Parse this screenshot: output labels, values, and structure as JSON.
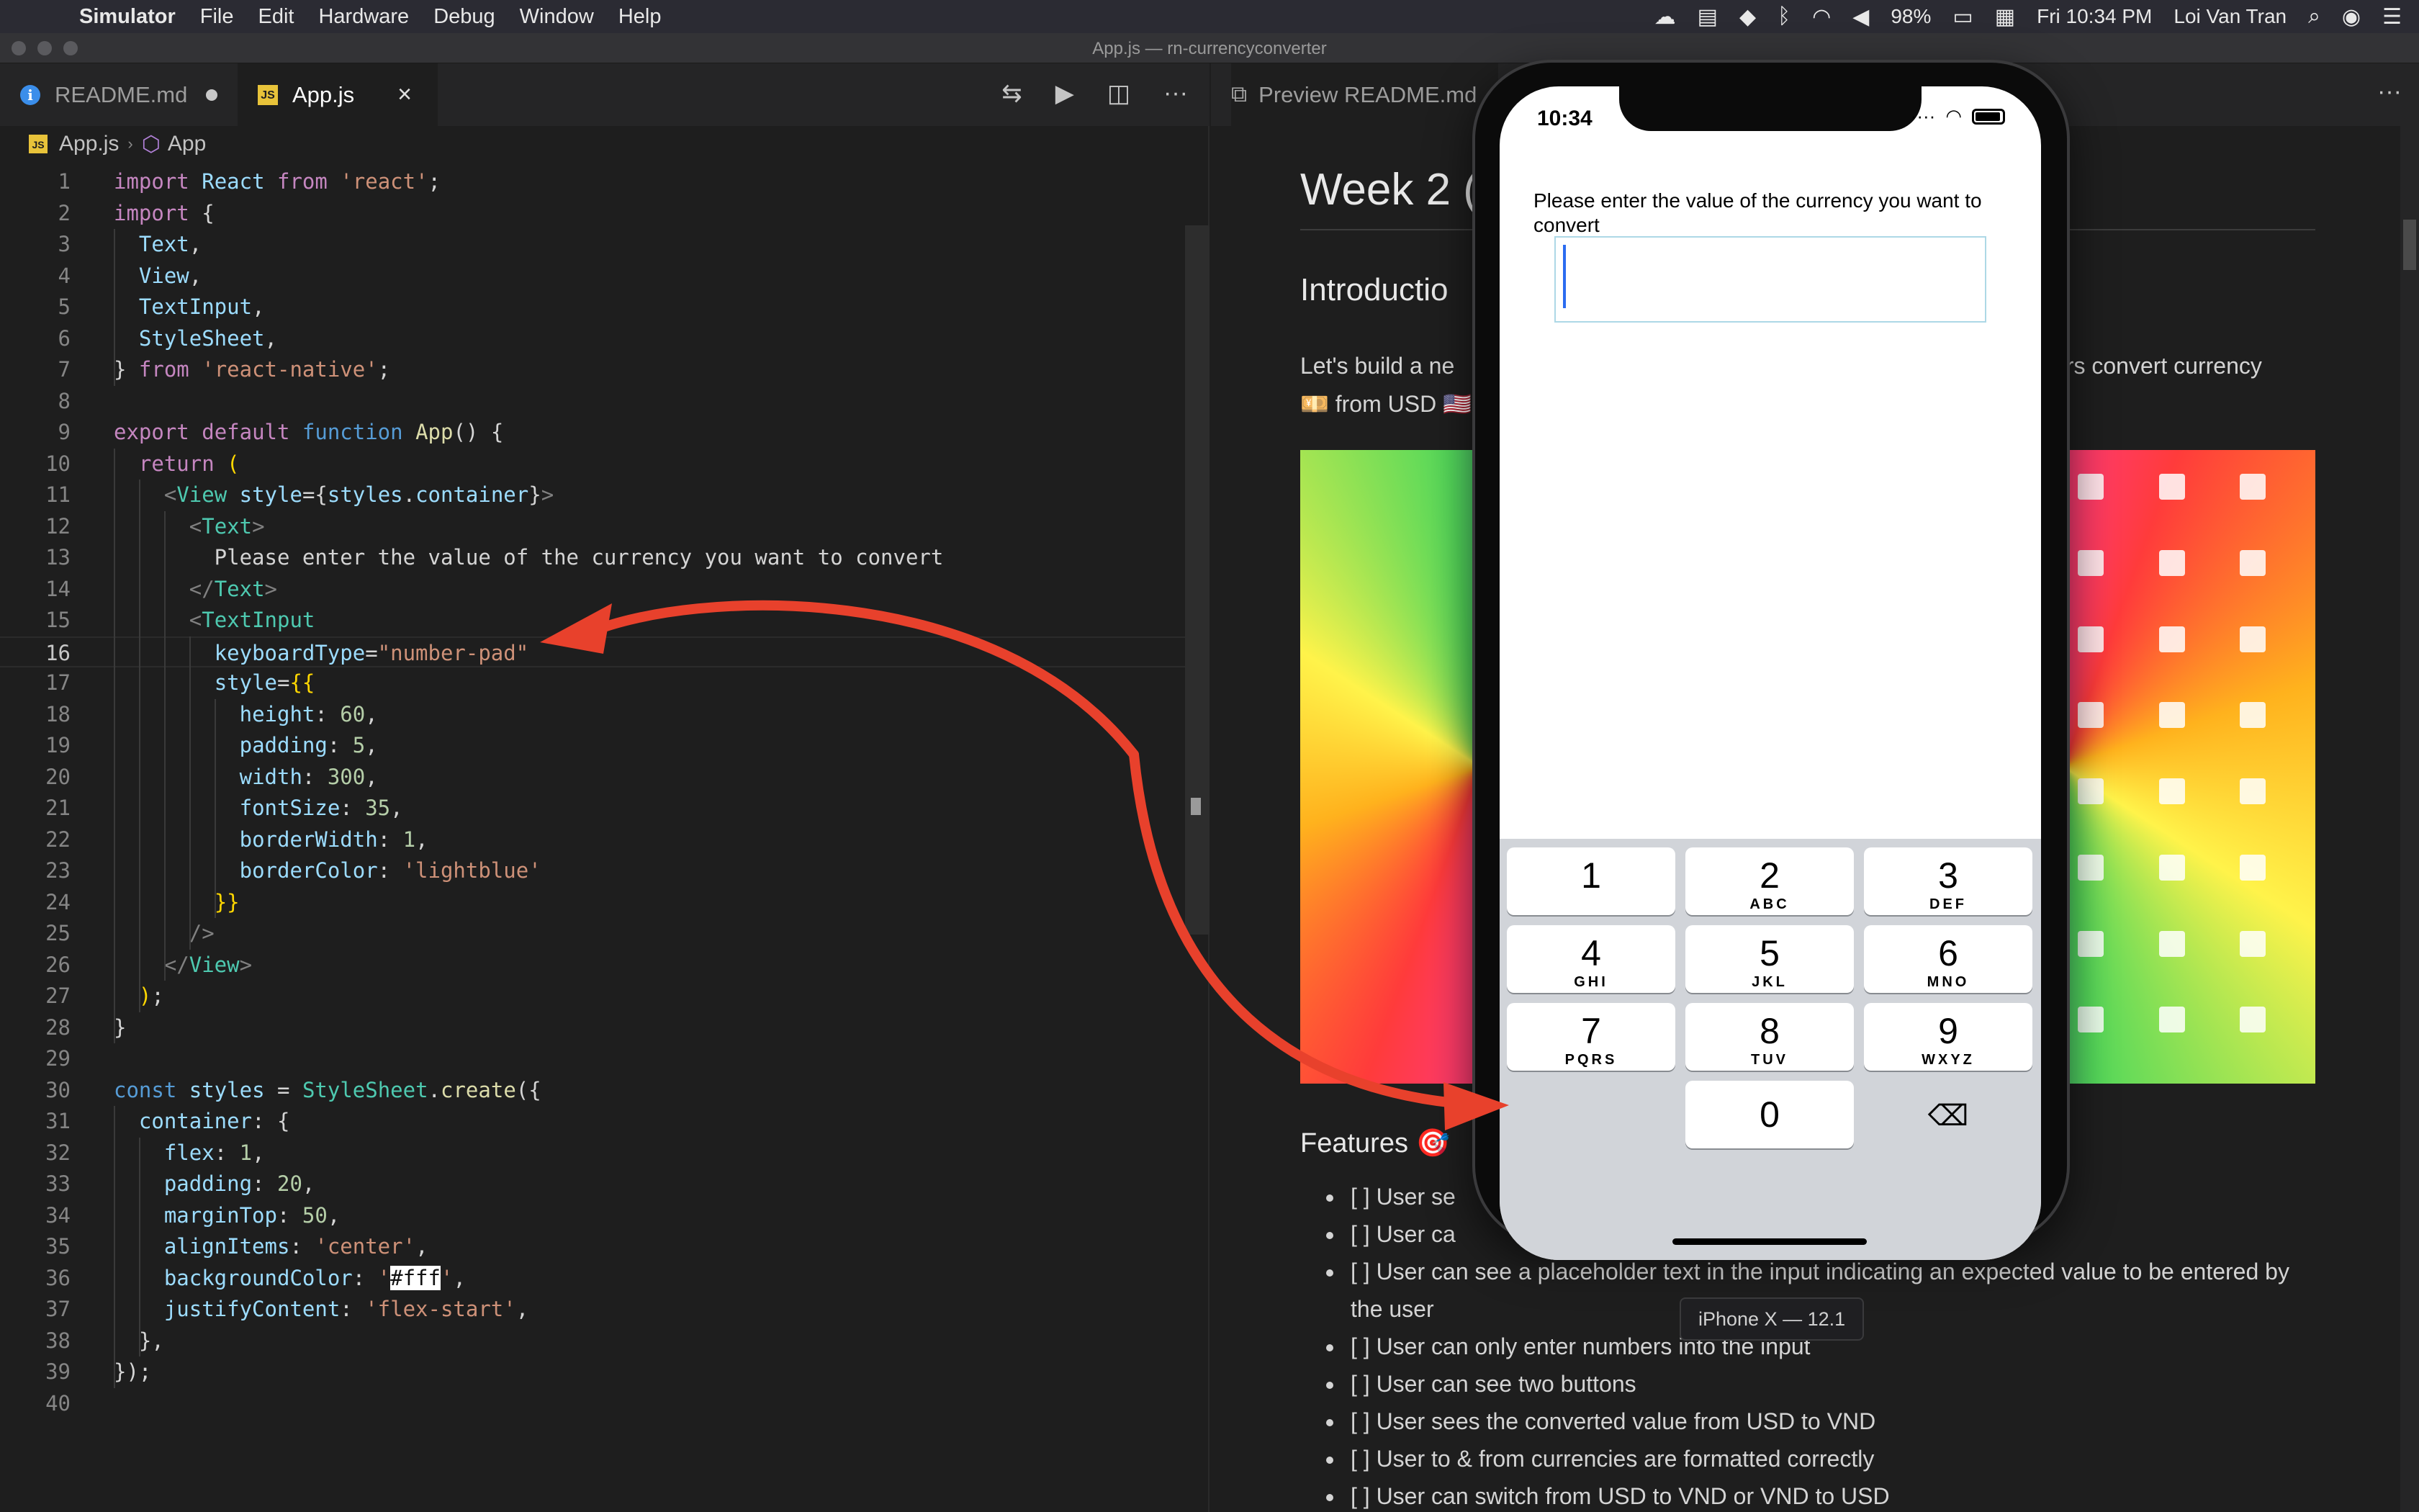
{
  "menubar": {
    "app_name": "Simulator",
    "items": [
      "File",
      "Edit",
      "Hardware",
      "Debug",
      "Window",
      "Help"
    ],
    "battery": "98%",
    "clock": "Fri 10:34 PM",
    "user": "Loi Van Tran"
  },
  "window": {
    "title": "App.js — rn-currencyconverter"
  },
  "editor": {
    "tabs": [
      {
        "label": "README.md",
        "icon": "info-icon",
        "modified": true
      },
      {
        "label": "App.js",
        "icon": "js-file-icon",
        "active": true
      }
    ],
    "breadcrumb": {
      "file": "App.js",
      "symbol": "App"
    },
    "current_line": 16,
    "lines": [
      {
        "n": "1"
      },
      {
        "n": "2"
      },
      {
        "n": "3"
      },
      {
        "n": "4"
      },
      {
        "n": "5"
      },
      {
        "n": "6"
      },
      {
        "n": "7"
      },
      {
        "n": "8"
      },
      {
        "n": "9"
      },
      {
        "n": "10"
      },
      {
        "n": "11"
      },
      {
        "n": "12"
      },
      {
        "n": "13"
      },
      {
        "n": "14"
      },
      {
        "n": "15"
      },
      {
        "n": "16"
      },
      {
        "n": "17"
      },
      {
        "n": "18"
      },
      {
        "n": "19"
      },
      {
        "n": "20"
      },
      {
        "n": "21"
      },
      {
        "n": "22"
      },
      {
        "n": "23"
      },
      {
        "n": "24"
      },
      {
        "n": "25"
      },
      {
        "n": "26"
      },
      {
        "n": "27"
      },
      {
        "n": "28"
      },
      {
        "n": "29"
      },
      {
        "n": "30"
      },
      {
        "n": "31"
      },
      {
        "n": "32"
      },
      {
        "n": "33"
      },
      {
        "n": "34"
      },
      {
        "n": "35"
      },
      {
        "n": "36"
      },
      {
        "n": "37"
      },
      {
        "n": "38"
      },
      {
        "n": "39"
      },
      {
        "n": "40"
      }
    ],
    "code": [
      [
        [
          "kw",
          "import"
        ],
        [
          "pun",
          " "
        ],
        [
          "var",
          "React"
        ],
        [
          "pun",
          " "
        ],
        [
          "kw",
          "from"
        ],
        [
          "pun",
          " "
        ],
        [
          "str",
          "'react'"
        ],
        [
          "pun",
          ";"
        ]
      ],
      [
        [
          "kw",
          "import"
        ],
        [
          "pun",
          " {"
        ]
      ],
      [
        [
          "pun",
          "  "
        ],
        [
          "var",
          "Text"
        ],
        [
          "pun",
          ","
        ]
      ],
      [
        [
          "pun",
          "  "
        ],
        [
          "var",
          "View"
        ],
        [
          "pun",
          ","
        ]
      ],
      [
        [
          "pun",
          "  "
        ],
        [
          "var",
          "TextInput"
        ],
        [
          "pun",
          ","
        ]
      ],
      [
        [
          "pun",
          "  "
        ],
        [
          "var",
          "StyleSheet"
        ],
        [
          "pun",
          ","
        ]
      ],
      [
        [
          "pun",
          "} "
        ],
        [
          "kw",
          "from"
        ],
        [
          "pun",
          " "
        ],
        [
          "str",
          "'react-native'"
        ],
        [
          "pun",
          ";"
        ]
      ],
      [],
      [
        [
          "kw",
          "export"
        ],
        [
          "pun",
          " "
        ],
        [
          "kw",
          "default"
        ],
        [
          "pun",
          " "
        ],
        [
          "kb",
          "function"
        ],
        [
          "pun",
          " "
        ],
        [
          "fn",
          "App"
        ],
        [
          "pun",
          "() {"
        ]
      ],
      [
        [
          "pun",
          "  "
        ],
        [
          "kw",
          "return"
        ],
        [
          "pun",
          " "
        ],
        [
          "brk",
          "("
        ]
      ],
      [
        [
          "pun",
          "    "
        ],
        [
          "gry",
          "<"
        ],
        [
          "cls",
          "View"
        ],
        [
          "pun",
          " "
        ],
        [
          "attr",
          "style"
        ],
        [
          "pun",
          "={"
        ],
        [
          "var",
          "styles"
        ],
        [
          "pun",
          "."
        ],
        [
          "var",
          "container"
        ],
        [
          "pun",
          "}"
        ],
        [
          "gry",
          ">"
        ]
      ],
      [
        [
          "pun",
          "      "
        ],
        [
          "gry",
          "<"
        ],
        [
          "cls",
          "Text"
        ],
        [
          "gry",
          ">"
        ]
      ],
      [
        [
          "pun",
          "        Please enter the value of the currency you want to convert"
        ]
      ],
      [
        [
          "pun",
          "      "
        ],
        [
          "gry",
          "</"
        ],
        [
          "cls",
          "Text"
        ],
        [
          "gry",
          ">"
        ]
      ],
      [
        [
          "pun",
          "      "
        ],
        [
          "gry",
          "<"
        ],
        [
          "cls",
          "TextInput"
        ]
      ],
      [
        [
          "pun",
          "        "
        ],
        [
          "attr",
          "keyboardType"
        ],
        [
          "pun",
          "="
        ],
        [
          "str",
          "\"number-pad\""
        ]
      ],
      [
        [
          "pun",
          "        "
        ],
        [
          "attr",
          "style"
        ],
        [
          "pun",
          "="
        ],
        [
          "brk",
          "{{"
        ]
      ],
      [
        [
          "pun",
          "          "
        ],
        [
          "var",
          "height"
        ],
        [
          "pun",
          ": "
        ],
        [
          "num",
          "60"
        ],
        [
          "pun",
          ","
        ]
      ],
      [
        [
          "pun",
          "          "
        ],
        [
          "var",
          "padding"
        ],
        [
          "pun",
          ": "
        ],
        [
          "num",
          "5"
        ],
        [
          "pun",
          ","
        ]
      ],
      [
        [
          "pun",
          "          "
        ],
        [
          "var",
          "width"
        ],
        [
          "pun",
          ": "
        ],
        [
          "num",
          "300"
        ],
        [
          "pun",
          ","
        ]
      ],
      [
        [
          "pun",
          "          "
        ],
        [
          "var",
          "fontSize"
        ],
        [
          "pun",
          ": "
        ],
        [
          "num",
          "35"
        ],
        [
          "pun",
          ","
        ]
      ],
      [
        [
          "pun",
          "          "
        ],
        [
          "var",
          "borderWidth"
        ],
        [
          "pun",
          ": "
        ],
        [
          "num",
          "1"
        ],
        [
          "pun",
          ","
        ]
      ],
      [
        [
          "pun",
          "          "
        ],
        [
          "var",
          "borderColor"
        ],
        [
          "pun",
          ": "
        ],
        [
          "str",
          "'lightblue'"
        ]
      ],
      [
        [
          "pun",
          "        "
        ],
        [
          "brk",
          "}}"
        ]
      ],
      [
        [
          "pun",
          "      "
        ],
        [
          "gry",
          "/>"
        ]
      ],
      [
        [
          "pun",
          "    "
        ],
        [
          "gry",
          "</"
        ],
        [
          "cls",
          "View"
        ],
        [
          "gry",
          ">"
        ]
      ],
      [
        [
          "pun",
          "  "
        ],
        [
          "brk",
          ")"
        ],
        [
          "pun",
          ";"
        ]
      ],
      [
        [
          "pun",
          "}"
        ]
      ],
      [],
      [
        [
          "kb",
          "const"
        ],
        [
          "pun",
          " "
        ],
        [
          "var",
          "styles"
        ],
        [
          "pun",
          " = "
        ],
        [
          "cls",
          "StyleSheet"
        ],
        [
          "pun",
          "."
        ],
        [
          "fn",
          "create"
        ],
        [
          "pun",
          "({"
        ]
      ],
      [
        [
          "pun",
          "  "
        ],
        [
          "var",
          "container"
        ],
        [
          "pun",
          ": {"
        ]
      ],
      [
        [
          "pun",
          "    "
        ],
        [
          "var",
          "flex"
        ],
        [
          "pun",
          ": "
        ],
        [
          "num",
          "1"
        ],
        [
          "pun",
          ","
        ]
      ],
      [
        [
          "pun",
          "    "
        ],
        [
          "var",
          "padding"
        ],
        [
          "pun",
          ": "
        ],
        [
          "num",
          "20"
        ],
        [
          "pun",
          ","
        ]
      ],
      [
        [
          "pun",
          "    "
        ],
        [
          "var",
          "marginTop"
        ],
        [
          "pun",
          ": "
        ],
        [
          "num",
          "50"
        ],
        [
          "pun",
          ","
        ]
      ],
      [
        [
          "pun",
          "    "
        ],
        [
          "var",
          "alignItems"
        ],
        [
          "pun",
          ": "
        ],
        [
          "str",
          "'center'"
        ],
        [
          "pun",
          ","
        ]
      ],
      [
        [
          "pun",
          "    "
        ],
        [
          "var",
          "backgroundColor"
        ],
        [
          "pun",
          ": "
        ],
        [
          "str",
          "'"
        ],
        [
          "hl",
          "#fff"
        ],
        [
          "str",
          "'"
        ],
        [
          "pun",
          ","
        ]
      ],
      [
        [
          "pun",
          "    "
        ],
        [
          "var",
          "justifyContent"
        ],
        [
          "pun",
          ": "
        ],
        [
          "str",
          "'flex-start'"
        ],
        [
          "pun",
          ","
        ]
      ],
      [
        [
          "pun",
          "  },"
        ]
      ],
      [
        [
          "pun",
          "});"
        ]
      ],
      []
    ]
  },
  "preview": {
    "tab_label": "Preview README.md",
    "h1": "Week 2 (",
    "h2": "Introductio",
    "para_start": "Let's build a ne",
    "para_end": "sers convert currency",
    "para_line2": "💴 from USD 🇺🇸",
    "features_heading": "Features 🎯",
    "features": [
      "[ ] User se",
      "[ ] User ca",
      "[ ] User can see a placeholder text in the input indicating an expected value to be entered by the user",
      "[ ] User can only enter numbers into the input",
      "[ ] User can see two buttons",
      "[ ] User sees the converted value from USD to VND",
      "[ ] User to & from currencies are formatted correctly",
      "[ ] User can switch from USD to VND or VND to USD"
    ]
  },
  "simulator": {
    "time": "10:34",
    "prompt": "Please enter the value of the currency you want to convert",
    "input_value": "",
    "input_border_color": "#add8e6",
    "keypad": [
      {
        "d": "1",
        "l": ""
      },
      {
        "d": "2",
        "l": "ABC"
      },
      {
        "d": "3",
        "l": "DEF"
      },
      {
        "d": "4",
        "l": "GHI"
      },
      {
        "d": "5",
        "l": "JKL"
      },
      {
        "d": "6",
        "l": "MNO"
      },
      {
        "d": "7",
        "l": "PQRS"
      },
      {
        "d": "8",
        "l": "TUV"
      },
      {
        "d": "9",
        "l": "WXYZ"
      }
    ],
    "zero_key": "0",
    "device_label": "iPhone X — 12.1"
  },
  "annotation": {
    "arrow_color": "#e8412c"
  }
}
